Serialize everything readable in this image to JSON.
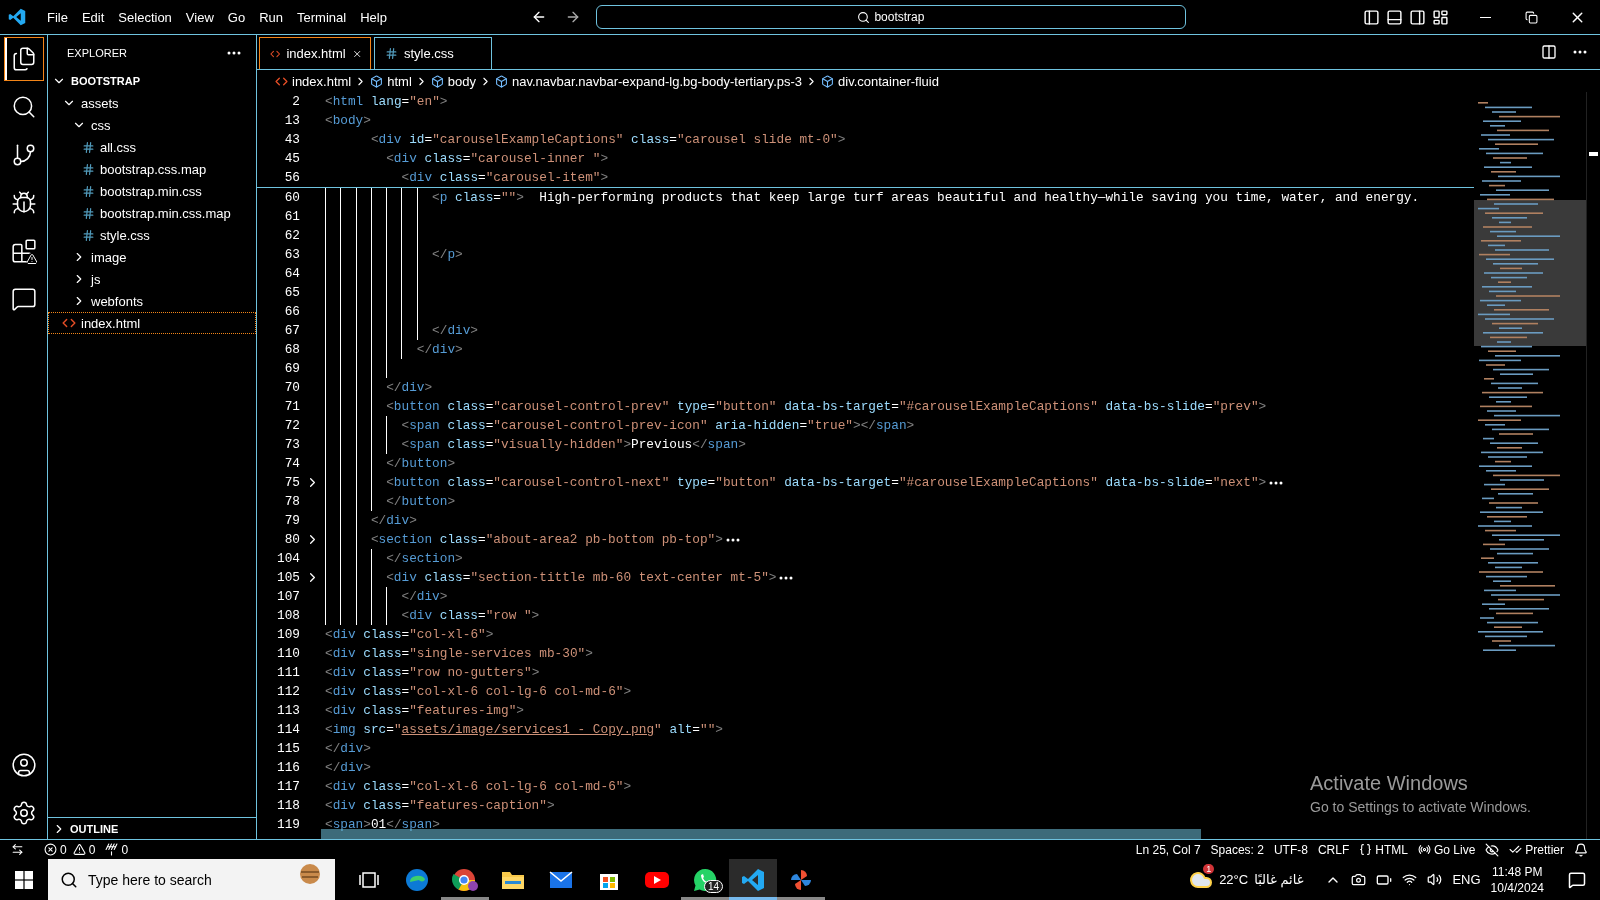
{
  "title_bar": {
    "menu": [
      "File",
      "Edit",
      "Selection",
      "View",
      "Go",
      "Run",
      "Terminal",
      "Help"
    ],
    "search": "bootstrap"
  },
  "activity_bar": [
    {
      "kind": "explorer",
      "selected": true
    },
    {
      "kind": "search",
      "selected": false
    },
    {
      "kind": "source-control",
      "selected": false
    },
    {
      "kind": "run",
      "selected": false
    },
    {
      "kind": "extensions",
      "selected": false
    },
    {
      "kind": "remote",
      "selected": false
    },
    {
      "kind": "accounts",
      "selected": false
    },
    {
      "kind": "manage",
      "selected": false
    }
  ],
  "sidebar": {
    "title": "EXPLORER",
    "tree": [
      {
        "label": "BOOTSTRAP",
        "kind": "root",
        "expanded": true,
        "selected": false,
        "children": [
          {
            "label": "assets",
            "kind": "folder",
            "expanded": true,
            "selected": false,
            "children": [
              {
                "label": "css",
                "kind": "folder",
                "expanded": true,
                "selected": false,
                "children": [
                  {
                    "label": "all.css",
                    "kind": "css",
                    "selected": false
                  },
                  {
                    "label": "bootstrap.css.map",
                    "kind": "css",
                    "selected": false
                  },
                  {
                    "label": "bootstrap.min.css",
                    "kind": "css",
                    "selected": false
                  },
                  {
                    "label": "bootstrap.min.css.map",
                    "kind": "css",
                    "selected": false
                  },
                  {
                    "label": "style.css",
                    "kind": "css",
                    "selected": false
                  }
                ]
              },
              {
                "label": "image",
                "kind": "folder",
                "expanded": false,
                "selected": false
              },
              {
                "label": "js",
                "kind": "folder",
                "expanded": false,
                "selected": false
              },
              {
                "label": "webfonts",
                "kind": "folder",
                "expanded": false,
                "selected": false
              }
            ]
          },
          {
            "label": "index.html",
            "kind": "html",
            "selected": true
          }
        ]
      }
    ],
    "outline": "OUTLINE"
  },
  "tabs": [
    {
      "label": "index.html",
      "kind": "html",
      "selected": true
    },
    {
      "label": "style.css",
      "kind": "css",
      "selected": false
    }
  ],
  "breadcrumbs": [
    {
      "label": "index.html",
      "kind": "file"
    },
    {
      "label": "html",
      "kind": "element"
    },
    {
      "label": "body",
      "kind": "element"
    },
    {
      "label": "nav.navbar.navbar-expand-lg.bg-body-tertiary.ps-3",
      "kind": "element"
    },
    {
      "label": "div.container-fluid",
      "kind": "element"
    }
  ],
  "editor": {
    "sticky_lines": [
      {
        "number": "2",
        "code": "<html lang=\"en\">"
      },
      {
        "number": "13",
        "code": "<body>"
      },
      {
        "number": "43",
        "code": "      <div id=\"carouselExampleCaptions\" class=\"carousel slide mt-0\">"
      },
      {
        "number": "45",
        "code": "        <div class=\"carousel-inner \">"
      },
      {
        "number": "56",
        "code": "          <div class=\"carousel-item\">"
      }
    ],
    "lines": [
      {
        "number": "60",
        "code": "              <p class=\"\">  High-performing products that keep large turf areas beautiful and healthy—while saving you time, water, and energy.",
        "folded": false
      },
      {
        "number": "61",
        "folded": false
      },
      {
        "number": "62",
        "folded": false
      },
      {
        "number": "63",
        "code": "              </p>",
        "folded": false
      },
      {
        "number": "64",
        "folded": false
      },
      {
        "number": "65",
        "folded": false
      },
      {
        "number": "66",
        "folded": false
      },
      {
        "number": "67",
        "code": "              </div>",
        "folded": false
      },
      {
        "number": "68",
        "code": "            </div>",
        "folded": false
      },
      {
        "number": "69",
        "folded": false
      },
      {
        "number": "70",
        "code": "        </div>",
        "folded": false
      },
      {
        "number": "71",
        "code": "        <button class=\"carousel-control-prev\" type=\"button\" data-bs-target=\"#carouselExampleCaptions\" data-bs-slide=\"prev\">",
        "folded": false
      },
      {
        "number": "72",
        "code": "          <span class=\"carousel-control-prev-icon\" aria-hidden=\"true\"></span>",
        "folded": false
      },
      {
        "number": "73",
        "code": "          <span class=\"visually-hidden\">Previous</span>",
        "folded": false
      },
      {
        "number": "74",
        "code": "        </button>",
        "folded": false
      },
      {
        "number": "75",
        "code": "        <button class=\"carousel-control-next\" type=\"button\" data-bs-target=\"#carouselExampleCaptions\" data-bs-slide=\"next\">",
        "folded": true
      },
      {
        "number": "78",
        "code": "        </button>",
        "folded": false
      },
      {
        "number": "79",
        "code": "      </div>",
        "folded": false
      },
      {
        "number": "80",
        "code": "      <section class=\"about-area2 pb-bottom pb-top\">",
        "folded": true
      },
      {
        "number": "104",
        "code": "        </section>",
        "folded": false
      },
      {
        "number": "105",
        "code": "        <div class=\"section-tittle mb-60 text-center mt-5\">",
        "folded": true
      },
      {
        "number": "107",
        "code": "          </div>",
        "folded": false
      },
      {
        "number": "108",
        "code": "          <div class=\"row \">",
        "folded": false
      },
      {
        "number": "109",
        "code": "<div class=\"col-xl-6\">",
        "folded": false
      },
      {
        "number": "110",
        "code": "<div class=\"single-services mb-30\">",
        "folded": false
      },
      {
        "number": "111",
        "code": "<div class=\"row no-gutters\">",
        "folded": false
      },
      {
        "number": "112",
        "code": "<div class=\"col-xl-6 col-lg-6 col-md-6\">",
        "folded": false
      },
      {
        "number": "113",
        "code": "<div class=\"features-img\">",
        "folded": false
      },
      {
        "number": "114",
        "code": "<img src=\"assets/image/services1 - Copy.png\" alt=\"\">",
        "folded": false,
        "link": true
      },
      {
        "number": "115",
        "code": "</div>",
        "folded": false
      },
      {
        "number": "116",
        "code": "</div>",
        "folded": false
      },
      {
        "number": "117",
        "code": "<div class=\"col-xl-6 col-lg-6 col-md-6\">",
        "folded": false
      },
      {
        "number": "118",
        "code": "<div class=\"features-caption\">",
        "folded": false
      },
      {
        "number": "119",
        "code": "<span>01</span>",
        "folded": false
      }
    ]
  },
  "activation_notice": {
    "title": "Activate Windows",
    "subtitle": "Go to Settings to activate Windows."
  },
  "status_bar": {
    "errors": "0",
    "warnings": "0",
    "ports": "0",
    "items": [
      {
        "text": "Ln 25, Col 7",
        "kind": "plain"
      },
      {
        "text": "Spaces: 2",
        "kind": "plain"
      },
      {
        "text": "UTF-8",
        "kind": "plain"
      },
      {
        "text": "CRLF",
        "kind": "plain"
      },
      {
        "text": "HTML",
        "kind": "language"
      },
      {
        "text": "Go Live",
        "kind": "live"
      },
      {
        "text": "Prettier",
        "kind": "prettier"
      }
    ]
  },
  "taskbar": {
    "search_placeholder": "Type here to search",
    "apps": [
      {
        "kind": "taskview",
        "running": false,
        "selected": false
      },
      {
        "kind": "edge",
        "running": false,
        "selected": false
      },
      {
        "kind": "chrome",
        "running": true,
        "selected": false
      },
      {
        "kind": "files",
        "running": false,
        "selected": false
      },
      {
        "kind": "mail",
        "running": false,
        "selected": false
      },
      {
        "kind": "store",
        "running": false,
        "selected": false
      },
      {
        "kind": "youtube",
        "running": false,
        "selected": false
      },
      {
        "kind": "whatsapp",
        "running": true,
        "selected": false,
        "badge": "14"
      },
      {
        "kind": "vscode",
        "running": true,
        "selected": true
      },
      {
        "kind": "pinwheel",
        "running": true,
        "selected": false
      }
    ],
    "weather": {
      "badge": "1",
      "temperature": "22°C",
      "condition": "غائم غالبًا"
    },
    "language": "ENG",
    "time": "11:48 PM",
    "date": "10/4/2024"
  }
}
